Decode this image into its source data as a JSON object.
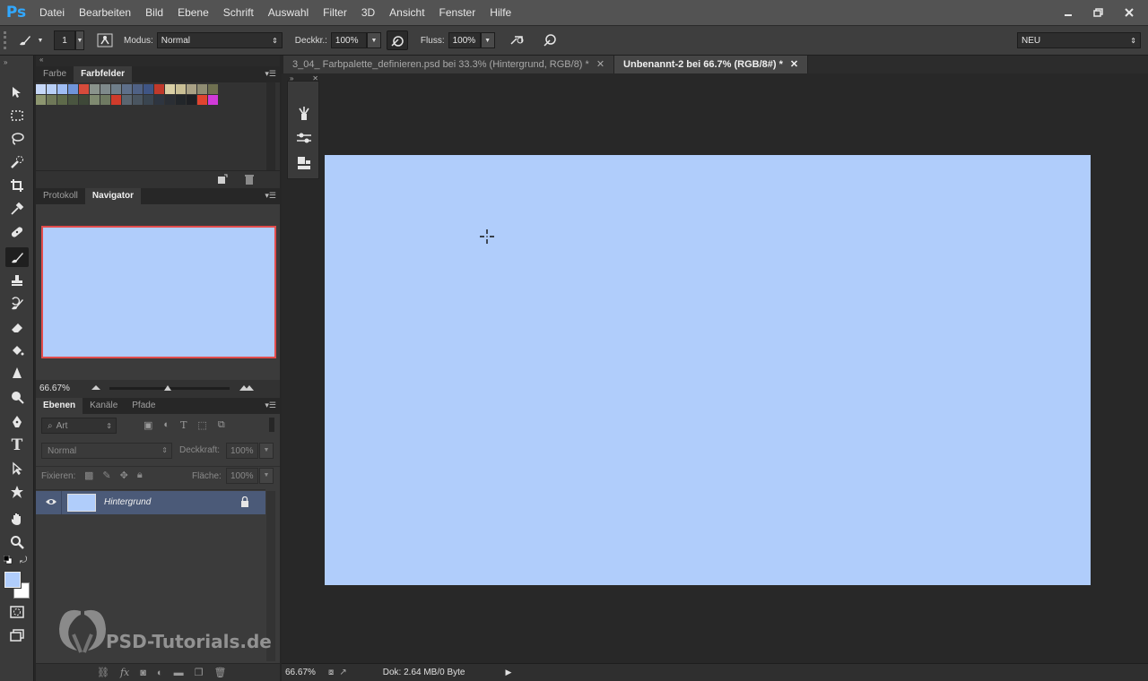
{
  "menu": {
    "app_logo": "Ps",
    "items": [
      "Datei",
      "Bearbeiten",
      "Bild",
      "Ebene",
      "Schrift",
      "Auswahl",
      "Filter",
      "3D",
      "Ansicht",
      "Fenster",
      "Hilfe"
    ]
  },
  "options_bar": {
    "brush_size": "1",
    "mode_label": "Modus:",
    "mode_value": "Normal",
    "opacity_label": "Deckkr.:",
    "opacity_value": "100%",
    "flow_label": "Fluss:",
    "flow_value": "100%",
    "workspace_value": "NEU"
  },
  "swatches_panel": {
    "tabs": [
      "Farbe",
      "Farbfelder"
    ],
    "active_tab": "Farbfelder",
    "row1": [
      "#c6d8f8",
      "#b8cff6",
      "#9fbdf3",
      "#6f94d9",
      "#d64b3b",
      "#8a938c",
      "#7f8a8c",
      "#6f7e8a",
      "#5e6f8a",
      "#4f6185",
      "#3f5585",
      "#c0392b",
      "#d9cfa5",
      "#c9bf95",
      "#a9a185",
      "#8f8c72",
      "#6f7050"
    ],
    "row2": [
      "#8d9670",
      "#6f7858",
      "#5e6a4a",
      "#4a5540",
      "#3e4838",
      "#7f8a70",
      "#6f7a62",
      "#d03b2b",
      "#5a6570",
      "#4a5560",
      "#3a4550",
      "#2e3540",
      "#2a2e34",
      "#22262a",
      "#1e2024",
      "#e0442f",
      "#d03ad8"
    ]
  },
  "navigator_panel": {
    "tabs": [
      "Protokoll",
      "Navigator"
    ],
    "active_tab": "Navigator",
    "zoom": "66.67%"
  },
  "layers_panel": {
    "tabs": [
      "Ebenen",
      "Kanäle",
      "Pfade"
    ],
    "active_tab": "Ebenen",
    "filter_kind": "Art",
    "blend_mode": "Normal",
    "opacity_label": "Deckkraft:",
    "opacity_value": "100%",
    "lock_label": "Fixieren:",
    "fill_label": "Fläche:",
    "fill_value": "100%",
    "layers": [
      {
        "name": "Hintergrund",
        "thumb_color": "#b0cdfb",
        "locked": true,
        "visible": true
      }
    ]
  },
  "documents": {
    "tabs": [
      {
        "title": "3_04_ Farbpalette_definieren.psd bei 33.3% (Hintergrund, RGB/8) *",
        "active": false
      },
      {
        "title": "Unbenannt-2 bei 66.7% (RGB/8#) *",
        "active": true
      }
    ],
    "canvas_color": "#b0cdfb"
  },
  "status_bar": {
    "zoom": "66.67%",
    "doc_info": "Dok: 2.64 MB/0 Byte"
  },
  "colors": {
    "foreground": "#b0cdfb",
    "background": "#ffffff",
    "accent_blue": "#31a8ff",
    "selected_layer": "#4b5a78"
  },
  "watermark": {
    "text": "PSD-Tutorials.de"
  }
}
